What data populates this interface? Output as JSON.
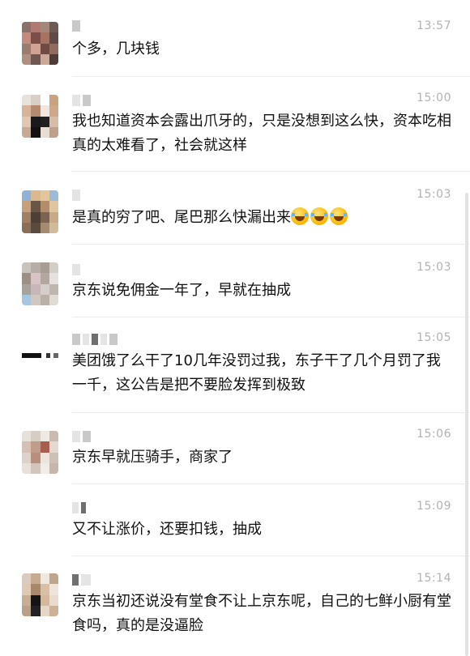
{
  "comments": [
    {
      "time": "13:57",
      "text": "个多，几块钱",
      "emoji": []
    },
    {
      "time": "15:00",
      "text": "我也知道资本会露出爪牙的，只是没想到这么快，资本吃相真的太难看了，社会就这样",
      "emoji": []
    },
    {
      "time": "15:03",
      "text": "是真的穷了吧、尾巴那么快漏出来",
      "emoji": [
        "face-with-tears-of-joy-icon",
        "face-with-tears-of-joy-icon",
        "face-with-tears-of-joy-icon"
      ]
    },
    {
      "time": "15:03",
      "text": "京东说免佣金一年了，早就在抽成",
      "emoji": []
    },
    {
      "time": "15:05",
      "text": "美团饿了么干了10几年没罚过我，东子干了几个月罚了我一千，这公告是把不要脸发挥到极致",
      "emoji": []
    },
    {
      "time": "15:06",
      "text": "京东早就压骑手，商家了",
      "emoji": []
    },
    {
      "time": "15:09",
      "text": "又不让涨价，还要扣钱，抽成",
      "emoji": []
    },
    {
      "time": "15:14",
      "text": "京东当初还说没有堂食不让上京东呢，自己的七鲜小厨有堂食吗，真的是没逼脸",
      "emoji": []
    }
  ]
}
